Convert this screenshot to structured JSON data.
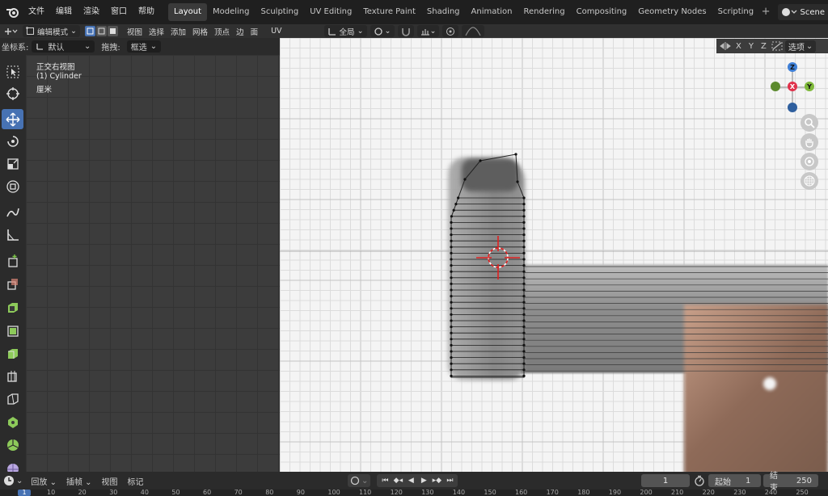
{
  "menu": {
    "items": [
      "文件",
      "编辑",
      "渲染",
      "窗口",
      "帮助"
    ]
  },
  "workspaces": [
    "Layout",
    "Modeling",
    "Sculpting",
    "UV Editing",
    "Texture Paint",
    "Shading",
    "Animation",
    "Rendering",
    "Compositing",
    "Geometry Nodes",
    "Scripting"
  ],
  "scene": {
    "label": "Scene"
  },
  "header": {
    "mode": "编辑模式",
    "menus": [
      "视图",
      "选择",
      "添加",
      "网格",
      "顶点",
      "边",
      "面",
      "UV"
    ],
    "transform_pivot": "全局",
    "select_label": "选项"
  },
  "subheader": {
    "orientation_label": "坐标系:",
    "orientation_value": "默认",
    "drag_label": "拖拽:",
    "drag_value": "框选"
  },
  "overlay": {
    "view_name": "正交右视图",
    "object_name": "(1) Cylinder",
    "units": "厘米"
  },
  "axes": {
    "x": "X",
    "y": "Y",
    "z": "Z"
  },
  "timeline": {
    "playback": "回放",
    "keying": "插帧",
    "view": "视图",
    "marker": "标记",
    "current_frame": "1",
    "start_label": "起始",
    "start_value": "1",
    "end_label": "结束",
    "end_value": "250"
  },
  "ruler": {
    "current": "1",
    "ticks": [
      "10",
      "20",
      "30",
      "40",
      "50",
      "60",
      "70",
      "80",
      "90",
      "100",
      "110",
      "120",
      "130",
      "140",
      "150",
      "160",
      "170",
      "180",
      "190",
      "200",
      "210",
      "220",
      "230",
      "240",
      "250"
    ]
  },
  "colors": {
    "accent": "#4772b3",
    "x_axis": "#e0314a",
    "y_axis": "#7eb83a",
    "z_axis": "#3e7fd6"
  }
}
